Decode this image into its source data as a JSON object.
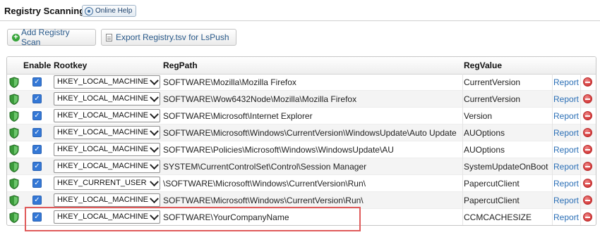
{
  "header": {
    "title": "Registry Scanning",
    "help_label": "Online Help"
  },
  "toolbar": {
    "add_label": "Add Registry Scan",
    "export_label": "Export Registry.tsv for LsPush"
  },
  "table": {
    "columns": {
      "enable": "Enable",
      "rootkey": "Rootkey",
      "regpath": "RegPath",
      "regvalue": "RegValue"
    },
    "rows": [
      {
        "enabled": true,
        "rootkey": "HKEY_LOCAL_MACHINE",
        "regpath": "SOFTWARE\\Mozilla\\Mozilla Firefox",
        "regvalue": "CurrentVersion",
        "report": "Report"
      },
      {
        "enabled": true,
        "rootkey": "HKEY_LOCAL_MACHINE",
        "regpath": "SOFTWARE\\Wow6432Node\\Mozilla\\Mozilla Firefox",
        "regvalue": "CurrentVersion",
        "report": "Report"
      },
      {
        "enabled": true,
        "rootkey": "HKEY_LOCAL_MACHINE",
        "regpath": "SOFTWARE\\Microsoft\\Internet Explorer",
        "regvalue": "Version",
        "report": "Report"
      },
      {
        "enabled": true,
        "rootkey": "HKEY_LOCAL_MACHINE",
        "regpath": "SOFTWARE\\Microsoft\\Windows\\CurrentVersion\\WindowsUpdate\\Auto Update",
        "regvalue": "AUOptions",
        "report": "Report"
      },
      {
        "enabled": true,
        "rootkey": "HKEY_LOCAL_MACHINE",
        "regpath": "SOFTWARE\\Policies\\Microsoft\\Windows\\WindowsUpdate\\AU",
        "regvalue": "AUOptions",
        "report": "Report"
      },
      {
        "enabled": true,
        "rootkey": "HKEY_LOCAL_MACHINE",
        "regpath": "SYSTEM\\CurrentControlSet\\Control\\Session Manager",
        "regvalue": "SystemUpdateOnBoot",
        "report": "Report"
      },
      {
        "enabled": true,
        "rootkey": "HKEY_CURRENT_USER",
        "regpath": "\\SOFTWARE\\Microsoft\\Windows\\CurrentVersion\\Run\\",
        "regvalue": "PapercutClient",
        "report": "Report"
      },
      {
        "enabled": true,
        "rootkey": "HKEY_LOCAL_MACHINE",
        "regpath": "SOFTWARE\\Microsoft\\Windows\\CurrentVersion\\Run\\",
        "regvalue": "PapercutClient",
        "report": "Report"
      },
      {
        "enabled": true,
        "rootkey": "HKEY_LOCAL_MACHINE",
        "regpath": "SOFTWARE\\YourCompanyName",
        "regvalue": "CCMCACHESIZE",
        "report": "Report"
      }
    ]
  },
  "colors": {
    "link": "#2b6fb6",
    "checkbox": "#3478d6",
    "delete": "#d43a3a",
    "shield": "#3a9a3a",
    "highlight": "#e05a5a"
  },
  "icons": {
    "help": "help-icon",
    "add": "plus-icon",
    "export": "document-icon",
    "row": "shield-icon",
    "delete": "delete-icon"
  }
}
